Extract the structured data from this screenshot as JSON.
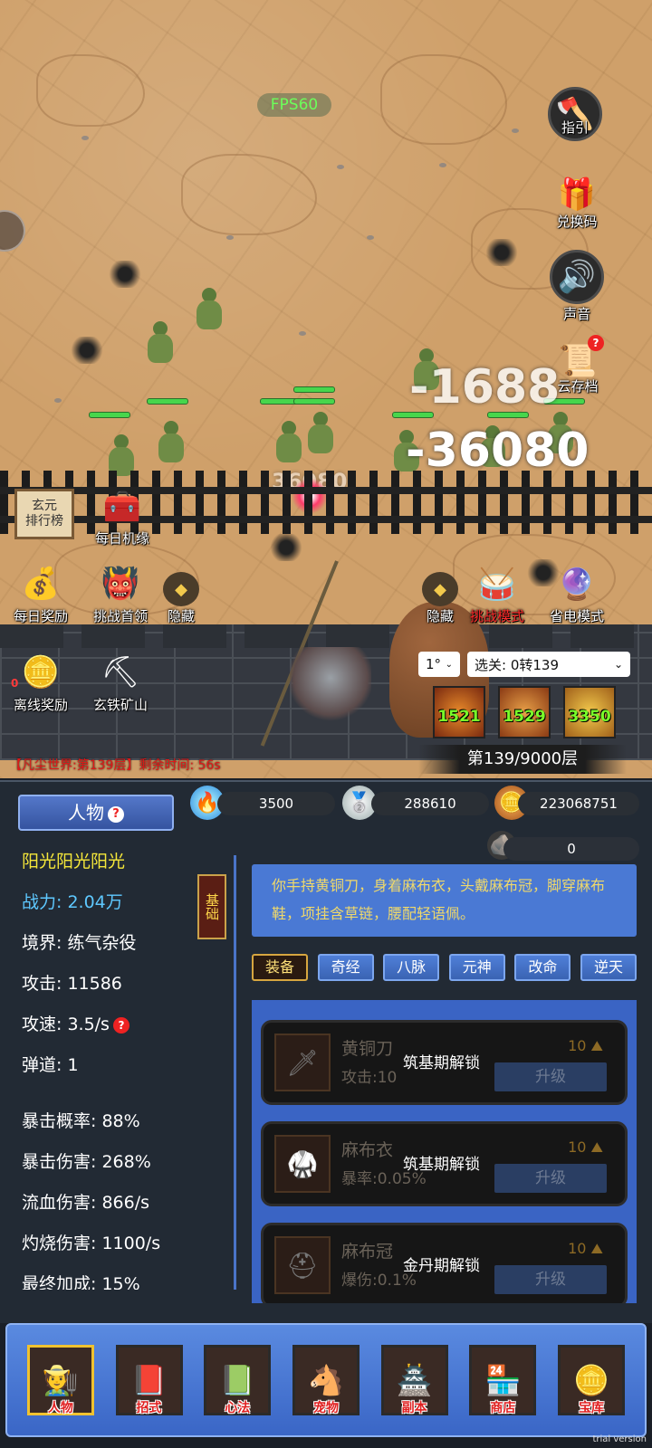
{
  "hud": {
    "fps": "FPS60",
    "guide": "指引",
    "redeem": "兑换码",
    "sound": "声音",
    "cloud_save": "云存档",
    "leaderboard": "玄元\n排行榜",
    "daily_chance": "每日机缘",
    "daily_reward": "每日奖励",
    "challenge_boss": "挑战首领",
    "hide_left": "隐藏",
    "hide_right": "隐藏",
    "challenge_mode": "挑战模式",
    "power_save_mode": "省电模式",
    "offline_reward": "离线奖励",
    "offline_badge": "0",
    "iron_mine": "玄铁矿山"
  },
  "battle": {
    "damage_1": "-1688",
    "damage_2": "-36080",
    "damage_3": "36080",
    "speed_select": "1°",
    "stage_select": "选关: 0转139",
    "skills": [
      "1521",
      "1529",
      "3350"
    ],
    "floor": "第139/9000层",
    "realm_info": "【凡尘世界:第139层】剩余时间: 56s"
  },
  "resources": {
    "spirit": "3500",
    "silver": "288610",
    "gold": "223068751",
    "ore": "0"
  },
  "character": {
    "tab_title": "人物",
    "basic_tab": "基础",
    "name": "阳光阳光阳光",
    "power": "战力: 2.04万",
    "realm": "境界: 练气杂役",
    "attack": "攻击: 11586",
    "attack_speed": "攻速: 3.5/s",
    "projectiles": "弹道: 1",
    "crit_rate": "暴击概率: 88%",
    "crit_damage": "暴击伤害: 268%",
    "bleed_damage": "流血伤害: 866/s",
    "burn_damage": "灼烧伤害: 1100/s",
    "final_bonus": "最终加成: 15%"
  },
  "description": "你手持黄铜刀，身着麻布衣，头戴麻布冠，脚穿麻布鞋，项挂含草链，腰配轻语佩。",
  "subtabs": [
    "装备",
    "奇经",
    "八脉",
    "元神",
    "改命",
    "逆天"
  ],
  "equipment": [
    {
      "name": "黄铜刀",
      "attr": "攻击:10",
      "lock": "筑基期解锁",
      "cost": "10",
      "button": "升级",
      "icon": "sword-icon"
    },
    {
      "name": "麻布衣",
      "attr": "暴率:0.05%",
      "lock": "筑基期解锁",
      "cost": "10",
      "button": "升级",
      "icon": "armor-icon"
    },
    {
      "name": "麻布冠",
      "attr": "爆伤:0.1%",
      "lock": "金丹期解锁",
      "cost": "10",
      "button": "升级",
      "icon": "helmet-icon"
    }
  ],
  "nav": [
    "人物",
    "招式",
    "心法",
    "宠物",
    "副本",
    "商店",
    "宝库"
  ],
  "watermark": "trial version",
  "colors": {
    "sand": "#cfa06a",
    "panel": "#222a34",
    "accent_blue": "#4a79d4",
    "hp_green": "#47d64c",
    "highlight_yellow": "#f5e73a",
    "power_blue": "#5ec8ff",
    "warning_red": "#e01818"
  }
}
